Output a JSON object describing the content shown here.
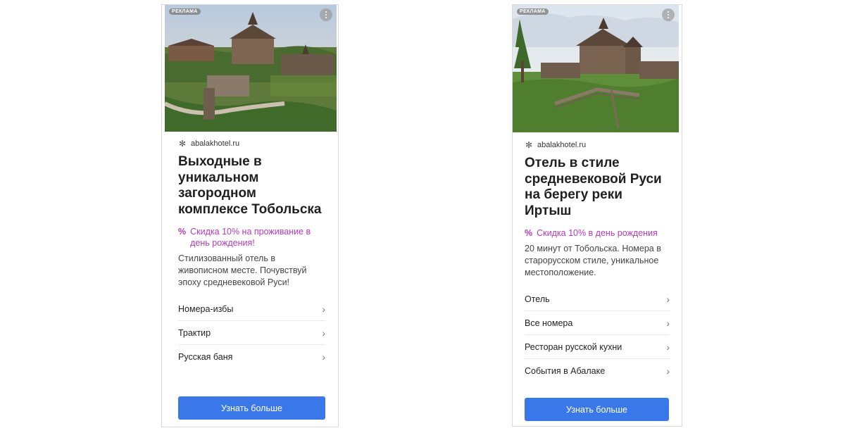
{
  "card1": {
    "badge": "РЕКЛАМА",
    "domain": "abalakhotel.ru",
    "headline": "Выходные в уникальном загородном комплексе Тобольска",
    "promo_icon": "%",
    "promo": "Скидка 10% на проживание в день рождения!",
    "description": "Стилизованный отель в живописном месте. Почувствуй эпоху средневековой Руси!",
    "links": [
      {
        "label": "Номера-избы"
      },
      {
        "label": "Трактир"
      },
      {
        "label": "Русская баня"
      }
    ],
    "cta": "Узнать больше"
  },
  "card2": {
    "badge": "РЕКЛАМА",
    "domain": "abalakhotel.ru",
    "headline": "Отель в стиле средневековой Руси на берегу реки Иртыш",
    "promo_icon": "%",
    "promo": "Скидка 10% в день рождения",
    "description": "20 минут от Тобольска. Номера в старорусском стиле, уникальное местоположение.",
    "links": [
      {
        "label": "Отель"
      },
      {
        "label": "Все номера"
      },
      {
        "label": "Ресторан русской кухни"
      },
      {
        "label": "События в Абалаке"
      }
    ],
    "cta": "Узнать больше"
  },
  "icons": {
    "domain": "snowflake-icon",
    "chevron": "chevron-right-icon",
    "menu": "more-vertical-icon"
  },
  "colors": {
    "accent": "#3a78e9",
    "promo": "#b23bb8"
  }
}
